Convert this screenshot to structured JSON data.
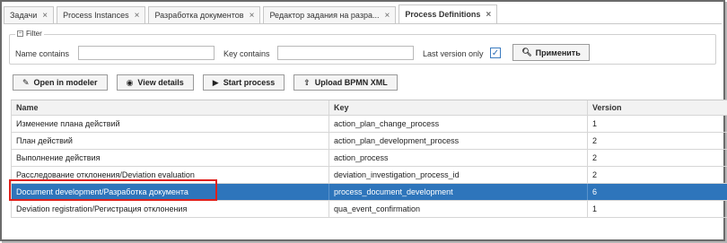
{
  "tabs": [
    {
      "label": "Задачи",
      "active": false
    },
    {
      "label": "Process Instances",
      "active": false
    },
    {
      "label": "Разработка документов",
      "active": false
    },
    {
      "label": "Редактор задания на разра...",
      "active": false
    },
    {
      "label": "Process Definitions",
      "active": true
    }
  ],
  "filter": {
    "legend": "Filter",
    "name_label": "Name contains",
    "name_value": "",
    "key_label": "Key contains",
    "key_value": "",
    "last_version_label": "Last version only",
    "last_version_checked": true,
    "apply_label": "Применить"
  },
  "toolbar": {
    "open_modeler": "Open in modeler",
    "view_details": "View details",
    "start_process": "Start process",
    "upload_bpmn": "Upload BPMN XML"
  },
  "table": {
    "columns": [
      "Name",
      "Key",
      "Version"
    ],
    "rows": [
      {
        "name": "Изменение плана действий",
        "key": "action_plan_change_process",
        "version": "1",
        "selected": false
      },
      {
        "name": "План действий",
        "key": "action_plan_development_process",
        "version": "2",
        "selected": false
      },
      {
        "name": "Выполнение действия",
        "key": "action_process",
        "version": "2",
        "selected": false
      },
      {
        "name": "Расследование отклонения/Deviation evaluation",
        "key": "deviation_investigation_process_id",
        "version": "2",
        "selected": false
      },
      {
        "name": "Document development/Разработка документа",
        "key": "process_document_development",
        "version": "6",
        "selected": true
      },
      {
        "name": "Deviation registration/Регистрация отклонения",
        "key": "qua_event_confirmation",
        "version": "1",
        "selected": false
      }
    ]
  },
  "colors": {
    "selected_row": "#2e75bb",
    "highlight": "#e0201b",
    "checkbox_accent": "#3c7cc0"
  },
  "icons": {
    "tab_close": "close-icon",
    "filter_collapse": "collapse-icon",
    "apply": "search-icon",
    "open_modeler": "edit-icon",
    "view_details": "eye-icon",
    "start_process": "play-icon",
    "upload_bpmn": "upload-icon"
  }
}
